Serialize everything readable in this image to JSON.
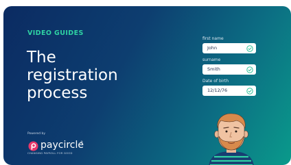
{
  "eyebrow": "VIDEO GUIDES",
  "title": [
    "The",
    "registration",
    "process"
  ],
  "form": {
    "fields": [
      {
        "label": "first name",
        "value": "John"
      },
      {
        "label": "surname",
        "value": "Smith"
      },
      {
        "label": "Date of birth",
        "value": "12/12/76"
      }
    ]
  },
  "brand": {
    "powered_by": "Powered by",
    "name": "paycircle",
    "trademark": "®",
    "tagline": "CHANGING PAYROLL FOR GOOD"
  },
  "colors": {
    "accent": "#2fd3a3",
    "logo_pink": "#e9386a"
  }
}
